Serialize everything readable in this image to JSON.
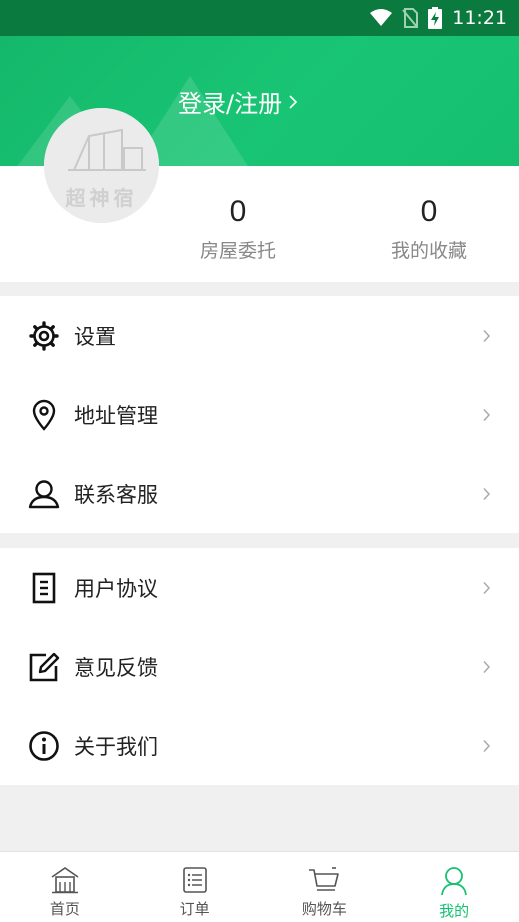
{
  "status_bar": {
    "time": "11:21"
  },
  "header": {
    "login_label": "登录/注册",
    "avatar_text": "超神宿"
  },
  "stats": [
    {
      "value": "0",
      "label": "房屋委托"
    },
    {
      "value": "0",
      "label": "我的收藏"
    }
  ],
  "menu_group_1": [
    {
      "label": "设置",
      "icon": "gear-icon"
    },
    {
      "label": "地址管理",
      "icon": "location-pin-icon"
    },
    {
      "label": "联系客服",
      "icon": "customer-service-icon"
    }
  ],
  "menu_group_2": [
    {
      "label": "用户协议",
      "icon": "document-icon"
    },
    {
      "label": "意见反馈",
      "icon": "edit-feedback-icon"
    },
    {
      "label": "关于我们",
      "icon": "info-icon"
    }
  ],
  "tabs": [
    {
      "label": "首页",
      "icon": "home-icon"
    },
    {
      "label": "订单",
      "icon": "order-list-icon"
    },
    {
      "label": "购物车",
      "icon": "cart-icon"
    },
    {
      "label": "我的",
      "icon": "user-icon",
      "active": true
    }
  ],
  "colors": {
    "accent": "#17c172",
    "status_bar": "#0b7a3e"
  }
}
